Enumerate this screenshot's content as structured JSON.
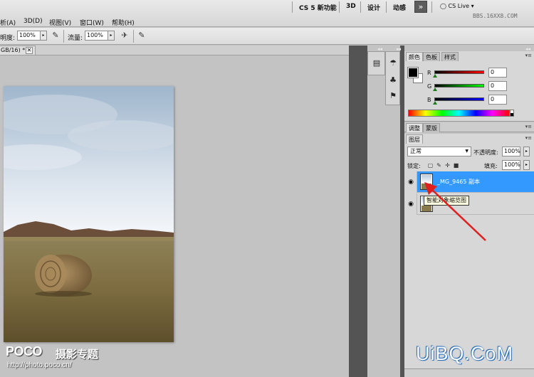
{
  "menubar": {
    "menus": [
      "析(A)",
      "3D(D)",
      "视图(V)",
      "窗口(W)",
      "帮助(H)"
    ],
    "workspaces": [
      "CS 5 新功能",
      "3D",
      "设计",
      "动感"
    ],
    "expand": "»",
    "cs_live": "CS Live",
    "watermark": "BBS.16XX8.COM"
  },
  "options": {
    "opacity_label": "明度:",
    "opacity_value": "100%",
    "flow_label": "流量:",
    "flow_value": "100%"
  },
  "document": {
    "tab_label": "GB/16) *",
    "close": "✕"
  },
  "panels": {
    "collapse": "◂◂",
    "color_tabs": [
      "颜色",
      "色板",
      "样式"
    ],
    "adjust_tabs": [
      "调整",
      "蒙版"
    ],
    "layers_tab": "图层",
    "menu_icon": "▾≡"
  },
  "color": {
    "channels": [
      {
        "label": "R",
        "value": "0",
        "gradient": "linear-gradient(to right,#000,#ff0000)"
      },
      {
        "label": "G",
        "value": "0",
        "gradient": "linear-gradient(to right,#000,#00ff00)"
      },
      {
        "label": "B",
        "value": "0",
        "gradient": "linear-gradient(to right,#000,#0000ff)"
      }
    ]
  },
  "layers": {
    "blend_mode": "正常",
    "opacity_label": "不透明度:",
    "opacity_value": "100%",
    "lock_label": "锁定:",
    "fill_label": "填充:",
    "fill_value": "100%",
    "items": [
      {
        "name": "_MG_9465 副本",
        "selected": true
      },
      {
        "name": "",
        "selected": false
      }
    ],
    "tooltip": "智能对象缩览图"
  },
  "watermarks": {
    "poco_logo": "POCO",
    "poco_title": "摄影专题",
    "poco_url": "http://photo.poco.cn/",
    "uibq": "UiBQ.CoM"
  },
  "colors": {
    "selection": "#3399ff",
    "arrow": "#e02020"
  }
}
